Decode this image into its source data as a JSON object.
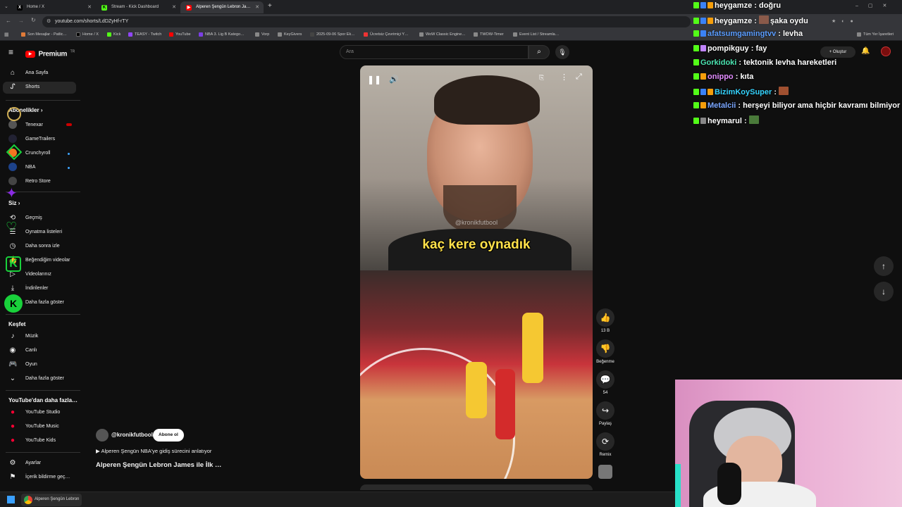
{
  "browser": {
    "tabs": [
      {
        "title": "Home / X",
        "fav": "x-icon",
        "color": "#000000"
      },
      {
        "title": "Stream - Kick Dashboard",
        "fav": "kick-icon",
        "color": "#53fc18"
      },
      {
        "title": "Alperen Şengün Lebron Ja…",
        "fav": "youtube-icon",
        "color": "#ff0000"
      }
    ],
    "new_tab": "+",
    "url": "youtube.com/shorts/LdDZyHf-rTY",
    "bookmarks": [
      "Son Mesajlar - Patlic…",
      "Home / X",
      "Kick",
      "TEASY - Twitch",
      "YouTube",
      "NBA 3. Lig B Katego…",
      "Vorp",
      "KeyGivers",
      "2025-09-06 Spor Ek…",
      "Ücretsiz Çevrimiçi Y…",
      "WoW Classic Engine…",
      "TWOW-Timer",
      "Event List / Streamla…"
    ],
    "all_bookmarks": "Tüm Yer İşaretleri"
  },
  "youtube": {
    "logo": "Premium",
    "logo_sup": "TR",
    "search_placeholder": "Ara",
    "create_label": "Oluştur",
    "nav": [
      {
        "label": "Ana Sayfa",
        "icon": "home-icon"
      },
      {
        "label": "Shorts",
        "icon": "shorts-icon"
      }
    ],
    "subs_header": "Abonelikler",
    "subs": [
      "Tenexar",
      "GameTrailers",
      "Crunchyroll",
      "NBA",
      "Retro Store"
    ],
    "you_header": "Siz",
    "you_items": [
      "Geçmiş",
      "Oynatma listeleri",
      "Daha sonra izle",
      "Beğendiğim videolar",
      "Videolarınız",
      "İndirilenler",
      "Daha fazla göster"
    ],
    "explore_header": "Keşfet",
    "explore_items": [
      "Müzik",
      "Canlı",
      "Oyun",
      "Daha fazla göster"
    ],
    "more_header": "YouTube'dan daha fazla…",
    "more_items": [
      "YouTube Studio",
      "YouTube Music",
      "YouTube Kids"
    ],
    "bottom_items": [
      "Ayarlar",
      "İçerik bildirme geç…"
    ]
  },
  "short": {
    "caption": "kaç kere oynadık",
    "watermark": "@kronikfutbool",
    "channel": "@kronikfutbool",
    "subscribe": "Abone ol",
    "description": "▶ Alperen Şengün NBA'ye gidiş sürecini anlatıyor",
    "title": "Alperen Şengün Lebron James ile İlk …",
    "likes": "13 B",
    "dislike_label": "Beğenme",
    "comments": "54",
    "share_label": "Paylaş",
    "remix_label": "Remix"
  },
  "chat": [
    {
      "user": "heygamze",
      "color": "#ffffff",
      "msg": "doğru"
    },
    {
      "user": "heygamze",
      "color": "#ffffff",
      "msg": "şaka oydu"
    },
    {
      "user": "afatsumgamingtvv",
      "color": "#5b9dff",
      "msg": "levha"
    },
    {
      "user": "pompikguy",
      "color": "#ffffff",
      "msg": "fay"
    },
    {
      "user": "Gorkidoki",
      "color": "#4be3b0",
      "msg": "tektonik levha hareketleri"
    },
    {
      "user": "onippo",
      "color": "#e28cff",
      "msg": "kıta"
    },
    {
      "user": "BizimKoySuper",
      "color": "#35d4ff",
      "msg": ""
    },
    {
      "user": "Metalcii",
      "color": "#7aa6ff",
      "msg": "herşeyi biliyor ama hiçbir kavramı bilmiyor"
    },
    {
      "user": "heymarul",
      "color": "#ffffff",
      "msg": ""
    }
  ],
  "taskbar": {
    "app_label": "Alperen Şengün Lebron"
  }
}
